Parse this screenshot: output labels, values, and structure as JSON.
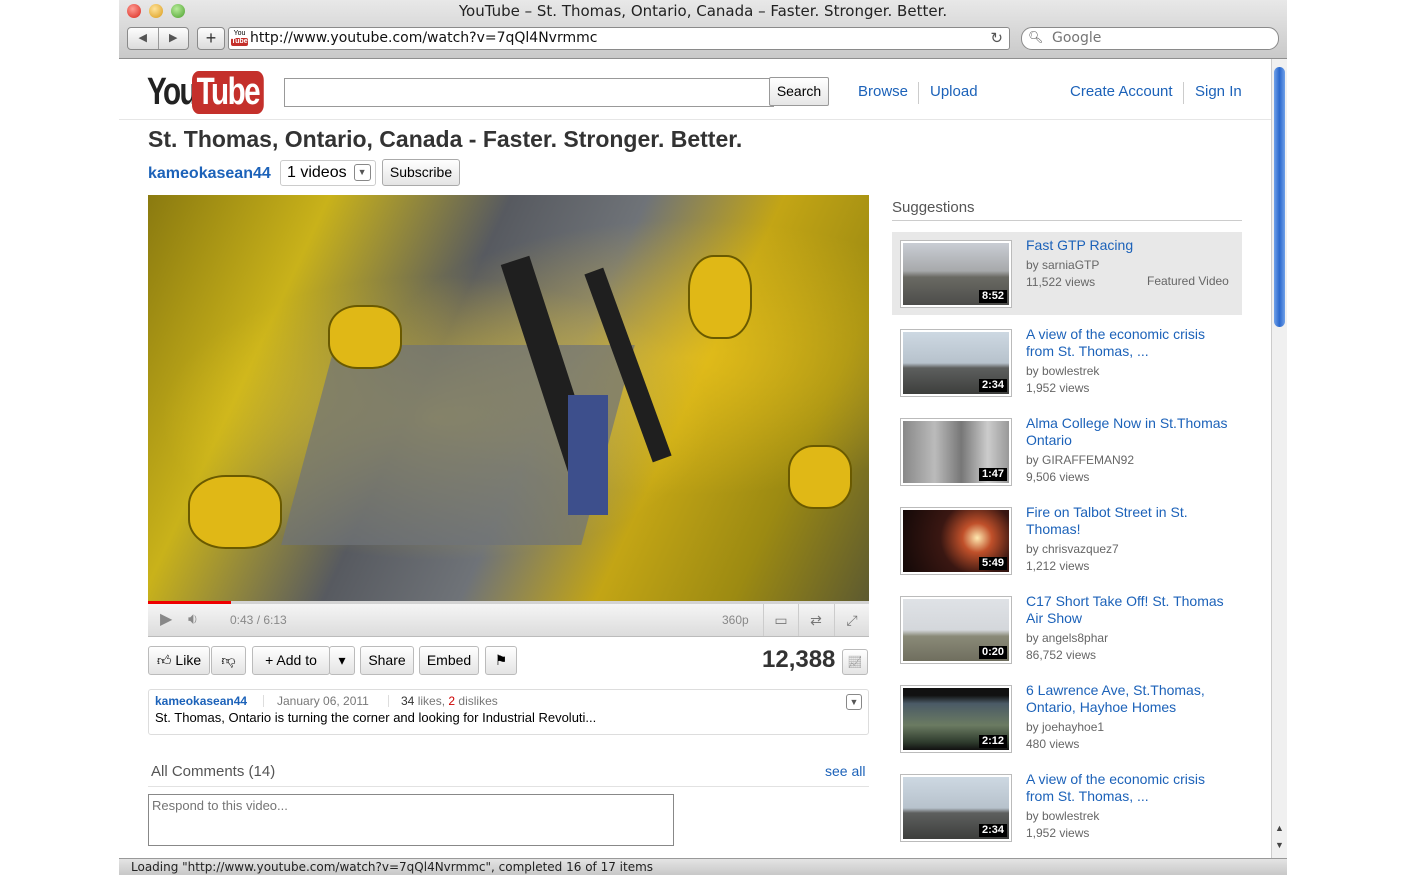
{
  "window": {
    "title": "YouTube – St. Thomas, Ontario, Canada – Faster. Stronger. Better."
  },
  "browser": {
    "url": "http://www.youtube.com/watch?v=7qQl4Nvrmmc",
    "search_placeholder": "Google",
    "favicon_top": "You",
    "favicon_bottom": "Tube",
    "status": "Loading \"http://www.youtube.com/watch?v=7qQl4Nvrmmc\", completed 16 of 17 items"
  },
  "header": {
    "logo_you": "You",
    "logo_tube": "Tube",
    "search_value": "",
    "search_button": "Search",
    "nav": {
      "browse": "Browse",
      "upload": "Upload",
      "create_account": "Create Account",
      "sign_in": "Sign In"
    }
  },
  "video": {
    "title": "St. Thomas, Ontario, Canada - Faster. Stronger. Better.",
    "uploader": "kameokasean44",
    "video_count": "1 videos",
    "subscribe": "Subscribe",
    "time": "0:43 / 6:13",
    "quality": "360p",
    "progress_played": 0.115,
    "views": "12,388",
    "actions": {
      "like": "Like",
      "add_to": "Add to",
      "share": "Share",
      "embed": "Embed"
    }
  },
  "info": {
    "uploader": "kameokasean44",
    "date": "January 06, 2011",
    "likes": "34",
    "likes_label": "likes,",
    "dislikes": "2",
    "dislikes_label": "dislikes",
    "description": "St. Thomas, Ontario is turning the corner and looking for Industrial Revoluti..."
  },
  "comments": {
    "header": "All Comments (14)",
    "see_all": "see all",
    "placeholder": "Respond to this video..."
  },
  "suggestions": {
    "header": "Suggestions",
    "featured_label": "Featured Video",
    "items": [
      {
        "title": "Fast GTP Racing",
        "by": "by sarniaGTP",
        "views": "11,522 views",
        "duration": "8:52"
      },
      {
        "title": "A view of the economic crisis from St. Thomas, ...",
        "by": "by bowlestrek",
        "views": "1,952 views",
        "duration": "2:34"
      },
      {
        "title": "Alma College Now in St.Thomas Ontario",
        "by": "by GIRAFFEMAN92",
        "views": "9,506 views",
        "duration": "1:47"
      },
      {
        "title": "Fire on Talbot Street in St. Thomas!",
        "by": "by chrisvazquez7",
        "views": "1,212 views",
        "duration": "5:49"
      },
      {
        "title": "C17 Short Take Off! St. Thomas Air Show",
        "by": "by angels8phar",
        "views": "86,752 views",
        "duration": "0:20"
      },
      {
        "title": "6 Lawrence Ave, St.Thomas, Ontario, Hayhoe Homes",
        "by": "by joehayhoe1",
        "views": "480 views",
        "duration": "2:12"
      },
      {
        "title": "A view of the economic crisis from St. Thomas, ...",
        "by": "by bowlestrek",
        "views": "1,952 views",
        "duration": "2:34"
      }
    ]
  }
}
